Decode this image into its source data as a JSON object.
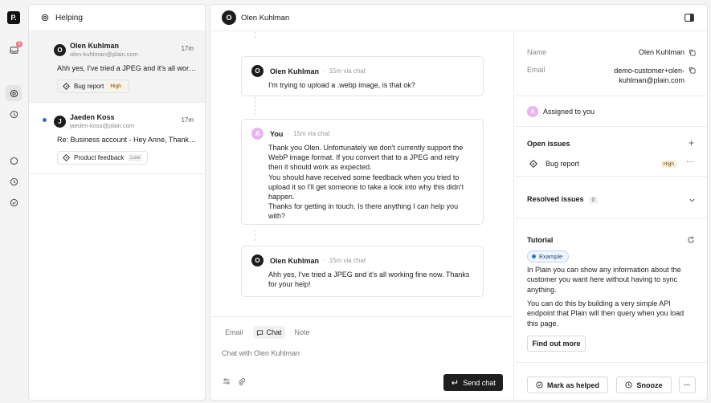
{
  "rail": {
    "logo_text": "P.",
    "inbox_badge": "3"
  },
  "list": {
    "title": "Helping",
    "threads": [
      {
        "name": "Olen Kuhlman",
        "email": "olen-kuhlman@plain.com",
        "avatar": "O",
        "time": "17m",
        "preview": "Ahh yes, I've tried a JPEG and it's all working fine now.",
        "label": "Bug report",
        "priority": "High"
      },
      {
        "name": "Jaeden Koss",
        "email": "jaeden-koss@plain.com",
        "avatar": "J",
        "time": "17m",
        "preview": "Re: Business account - Hey Anne, Thanks for reaching out.",
        "label": "Product feedback",
        "priority": "Low"
      }
    ]
  },
  "header": {
    "avatar": "O",
    "title": "Olen Kuhlman"
  },
  "messages": [
    {
      "avatar": "O",
      "author": "Olen Kuhlman",
      "meta": "15m via chat",
      "body": "I'm trying to upload a .webp image, is that ok?"
    },
    {
      "avatar": "A",
      "author": "You",
      "meta": "15m via chat",
      "body": "Thank you Olen. Unfortunately we don't currently support the\nWebP image format. If you convert that to a JPEG and retry\nthen it should work as expected.\nYou should have received some feedback when you tried to\nupload it so I'll get someone to take a look into why this didn't\nhappen.\nThanks for getting in touch. Is there anything I can help you\nwith?"
    },
    {
      "avatar": "O",
      "author": "Olen Kuhlman",
      "meta": "15m via chat",
      "body": "Ahh yes, I've tried a JPEG and it's all working fine now. Thanks\nfor your help!"
    }
  ],
  "composer": {
    "tabs": [
      "Email",
      "Chat",
      "Note"
    ],
    "placeholder": "Chat with Olen Kuhlman",
    "send_label": "Send chat"
  },
  "details": {
    "name_label": "Name",
    "name_value": "Olen Kuhlman",
    "email_label": "Email",
    "email_value_line1": "demo-customer+olen-",
    "email_value_line2": "kuhlman@plain.com",
    "assignee_avatar": "A",
    "assignee_text": "Assigned to you",
    "open_issues_title": "Open issues",
    "open_issue_label": "Bug report",
    "open_issue_priority": "High",
    "resolved_issues_title": "Resolved issues",
    "resolved_count": "0",
    "tutorial_title": "Tutorial",
    "example_chip": "Example",
    "tutorial_p1": "In Plain you can show any information about the customer you want here without having to sync anything.",
    "tutorial_p2": "You can do this by building a very simple API endpoint that Plain will then query when you load this page.",
    "find_out_more": "Find out more",
    "mark_helped": "Mark as helped",
    "snooze": "Snooze",
    "more": "···"
  }
}
